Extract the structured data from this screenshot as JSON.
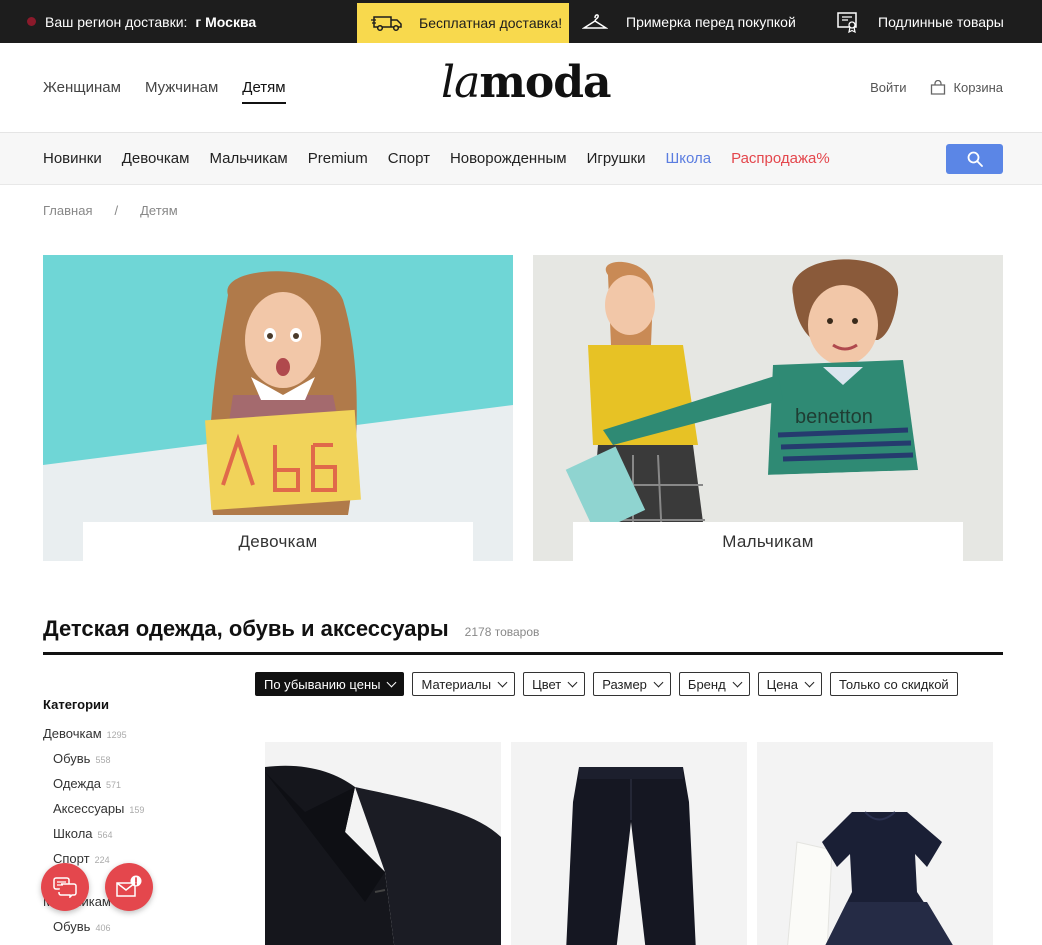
{
  "topbar": {
    "region_label": "Ваш регион доставки:",
    "region_city": "г Москва",
    "promo": "Бесплатная доставка!",
    "perk_fitting": "Примерка перед покупкой",
    "perk_authentic": "Подлинные товары"
  },
  "header": {
    "gender_nav": [
      "Женщинам",
      "Мужчинам",
      "Детям"
    ],
    "active_gender": "Детям",
    "logo_la": "la",
    "logo_moda": "moda",
    "login": "Войти",
    "cart": "Корзина"
  },
  "catnav": {
    "items": [
      "Новинки",
      "Девочкам",
      "Мальчикам",
      "Premium",
      "Спорт",
      "Новорожденным",
      "Игрушки"
    ],
    "school": "Школа",
    "sale": "Распродажа%",
    "accent_color": "#5b86e6",
    "sale_color": "#e4474d"
  },
  "breadcrumb": [
    "Главная",
    "/",
    "Детям"
  ],
  "banners": {
    "girls_label": "Девочкам",
    "boys_label": "Мальчикам"
  },
  "catalog": {
    "title": "Детская одежда, обувь и аксессуары",
    "count": "2178 товаров"
  },
  "filters": {
    "sort": "По убыванию цены",
    "materials": "Материалы",
    "color": "Цвет",
    "size": "Размер",
    "brand": "Бренд",
    "price": "Цена",
    "discount_only": "Только со скидкой"
  },
  "sidebar": {
    "heading": "Категории",
    "categories": [
      {
        "name": "Девочкам",
        "count": "1295",
        "sub": false
      },
      {
        "name": "Обувь",
        "count": "558",
        "sub": true
      },
      {
        "name": "Одежда",
        "count": "571",
        "sub": true
      },
      {
        "name": "Аксессуары",
        "count": "159",
        "sub": true
      },
      {
        "name": "Школа",
        "count": "564",
        "sub": true
      },
      {
        "name": "Спорт",
        "count": "224",
        "sub": true
      },
      {
        "name": "Мальчикам",
        "count": "",
        "sub": false
      },
      {
        "name": "Обувь",
        "count": "406",
        "sub": true
      }
    ]
  }
}
